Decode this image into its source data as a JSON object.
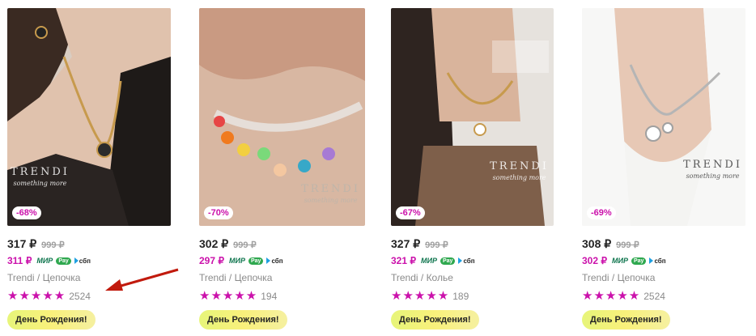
{
  "colors": {
    "accent": "#cb11ab",
    "arrow": "#c11a0d",
    "promo": "#e7f57a"
  },
  "products": [
    {
      "discount": "-68%",
      "price": "317 ₽",
      "old_price": "999 ₽",
      "wallet_price": "311 ₽",
      "payment_labels": {
        "mir": "МИР",
        "pay": "Pay",
        "sbp": "сбп"
      },
      "title": "Trendi / Цепочка",
      "stars": "★★★★★",
      "reviews": "2524",
      "promo": "День Рождения!",
      "brand": "TRENDI",
      "brand_sub": "something more"
    },
    {
      "discount": "-70%",
      "price": "302 ₽",
      "old_price": "999 ₽",
      "wallet_price": "297 ₽",
      "payment_labels": {
        "mir": "МИР",
        "pay": "Pay",
        "sbp": "сбп"
      },
      "title": "Trendi / Цепочка",
      "stars": "★★★★★",
      "reviews": "194",
      "promo": "День Рождения!",
      "brand": "TRENDI",
      "brand_sub": "something more"
    },
    {
      "discount": "-67%",
      "price": "327 ₽",
      "old_price": "999 ₽",
      "wallet_price": "321 ₽",
      "payment_labels": {
        "mir": "МИР",
        "pay": "Pay",
        "sbp": "сбп"
      },
      "title": "Trendi / Колье",
      "stars": "★★★★★",
      "reviews": "189",
      "promo": "День Рождения!",
      "brand": "TRENDI",
      "brand_sub": "something more"
    },
    {
      "discount": "-69%",
      "price": "308 ₽",
      "old_price": "999 ₽",
      "wallet_price": "302 ₽",
      "payment_labels": {
        "mir": "МИР",
        "pay": "Pay",
        "sbp": "сбп"
      },
      "title": "Trendi / Цепочка",
      "stars": "★★★★★",
      "reviews": "2524",
      "promo": "День Рождения!",
      "brand": "TRENDI",
      "brand_sub": "something more"
    }
  ]
}
